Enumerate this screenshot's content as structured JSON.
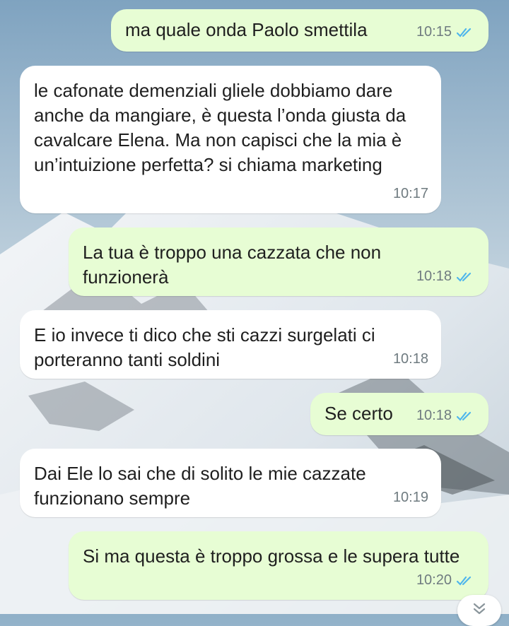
{
  "colors": {
    "outgoing_bubble": "#e7fdd4",
    "incoming_bubble": "#ffffff",
    "read_ticks": "#4fb6ec",
    "time_text": "#6f7b80"
  },
  "messages": [
    {
      "direction": "outgoing",
      "text": "ma quale onda Paolo smettila",
      "time": "10:15",
      "status": "read"
    },
    {
      "direction": "incoming",
      "text": "le cafonate demenziali gliele dobbiamo dare anche da mangiare, è questa l’onda giusta da cavalcare Elena. Ma non capisci che la mia è un’intuizione perfetta? si chiama marketing",
      "time": "10:17"
    },
    {
      "direction": "outgoing",
      "text": "La tua è troppo una cazzata che non funzionerà",
      "time": "10:18",
      "status": "read"
    },
    {
      "direction": "incoming",
      "text": "E io invece ti dico che sti cazzi surgelati ci porteranno tanti soldini",
      "time": "10:18"
    },
    {
      "direction": "outgoing",
      "text": "Se certo",
      "time": "10:18",
      "status": "read"
    },
    {
      "direction": "incoming",
      "text": "Dai Ele lo sai che di solito le mie cazzate funzionano sempre",
      "time": "10:19"
    },
    {
      "direction": "outgoing",
      "text": "Si ma questa è troppo grossa e le supera tutte",
      "time": "10:20",
      "status": "read"
    }
  ],
  "scroll_button_icon": "double-chevron-down-icon",
  "background": "mountain-snow-wallpaper"
}
